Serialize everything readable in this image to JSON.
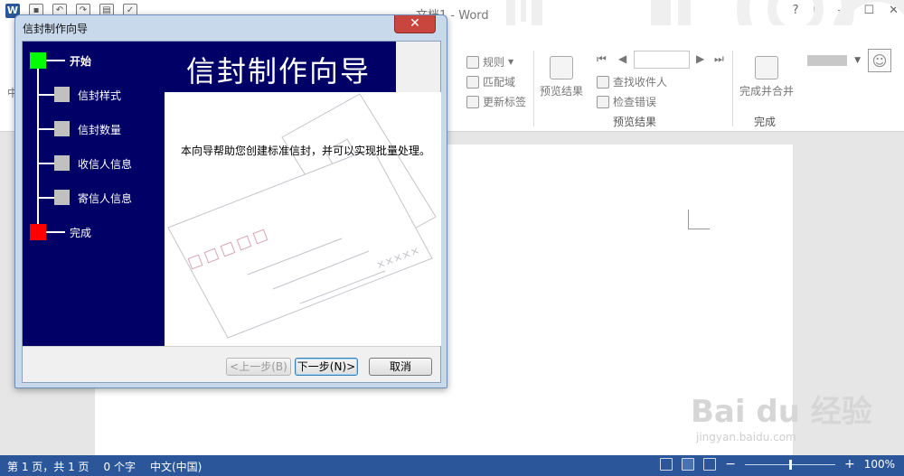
{
  "word": {
    "title": "文档1 - Word",
    "window_controls": [
      "?",
      "⊡",
      "—",
      "☐",
      "✕"
    ],
    "ribbon": {
      "left_partial": "中",
      "rules_label": "规则",
      "match_fields_label": "匹配域",
      "update_labels_label": "更新标签",
      "preview_results_button": "预览结果",
      "find_recipient_label": "查找收件人",
      "check_errors_label": "检查错误",
      "group_preview_results": "预览结果",
      "finish_merge_button": "完成并合并",
      "group_finish": "完成"
    },
    "statusbar": {
      "page_info": "第 1 页，共 1 页",
      "word_count": "0 个字",
      "language": "中文(中国)",
      "zoom_minus": "−",
      "zoom_plus": "+",
      "zoom_level": "100%",
      "zoom_fraction": 0.5
    }
  },
  "dialog": {
    "title": "信封制作向导",
    "close_label": "✕",
    "header_title": "信封制作向导",
    "steps": [
      {
        "label": "开始",
        "state": "current"
      },
      {
        "label": "信封样式",
        "state": "pending"
      },
      {
        "label": "信封数量",
        "state": "pending"
      },
      {
        "label": "收信人信息",
        "state": "pending"
      },
      {
        "label": "寄信人信息",
        "state": "pending"
      },
      {
        "label": "完成",
        "state": "end"
      }
    ],
    "description": "本向导帮助您创建标准信封，并可以实现批量处理。",
    "envelope_marks": "×××××",
    "buttons": {
      "back": "<上一步(B)",
      "next": "下一步(N)>",
      "cancel": "取消"
    }
  },
  "watermark": {
    "main": "Bai du 经验",
    "sub": "jingyan.baidu.com"
  },
  "colors": {
    "wizard_panel": "#000066",
    "step_current": "#00ff00",
    "step_end": "#ff0000",
    "step_pending": "#c0c0c0",
    "statusbar": "#2b579a"
  }
}
